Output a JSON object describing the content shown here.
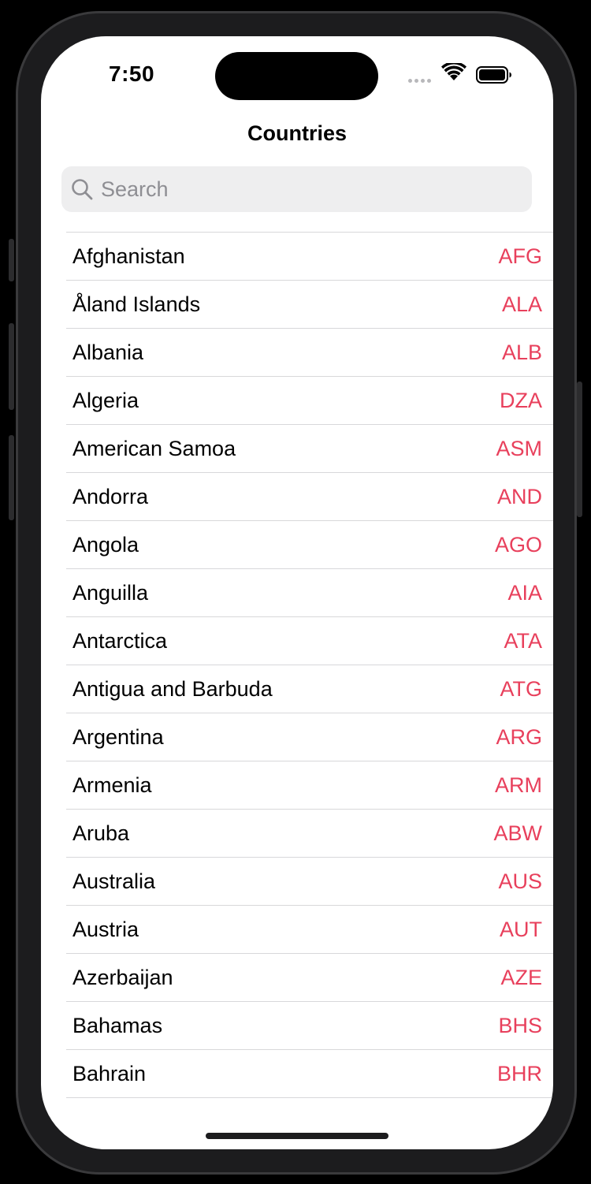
{
  "status_bar": {
    "time": "7:50"
  },
  "nav": {
    "title": "Countries"
  },
  "search": {
    "placeholder": "Search",
    "icon": "magnifying-glass"
  },
  "colors": {
    "code_accent": "#e8405c",
    "search_background": "#eeeeef",
    "separator": "#d8d8da"
  },
  "countries": [
    {
      "name": "Afghanistan",
      "code": "AFG"
    },
    {
      "name": "Åland Islands",
      "code": "ALA"
    },
    {
      "name": "Albania",
      "code": "ALB"
    },
    {
      "name": "Algeria",
      "code": "DZA"
    },
    {
      "name": "American Samoa",
      "code": "ASM"
    },
    {
      "name": "Andorra",
      "code": "AND"
    },
    {
      "name": "Angola",
      "code": "AGO"
    },
    {
      "name": "Anguilla",
      "code": "AIA"
    },
    {
      "name": "Antarctica",
      "code": "ATA"
    },
    {
      "name": "Antigua and Barbuda",
      "code": "ATG"
    },
    {
      "name": "Argentina",
      "code": "ARG"
    },
    {
      "name": "Armenia",
      "code": "ARM"
    },
    {
      "name": "Aruba",
      "code": "ABW"
    },
    {
      "name": "Australia",
      "code": "AUS"
    },
    {
      "name": "Austria",
      "code": "AUT"
    },
    {
      "name": "Azerbaijan",
      "code": "AZE"
    },
    {
      "name": "Bahamas",
      "code": "BHS"
    },
    {
      "name": "Bahrain",
      "code": "BHR"
    }
  ]
}
